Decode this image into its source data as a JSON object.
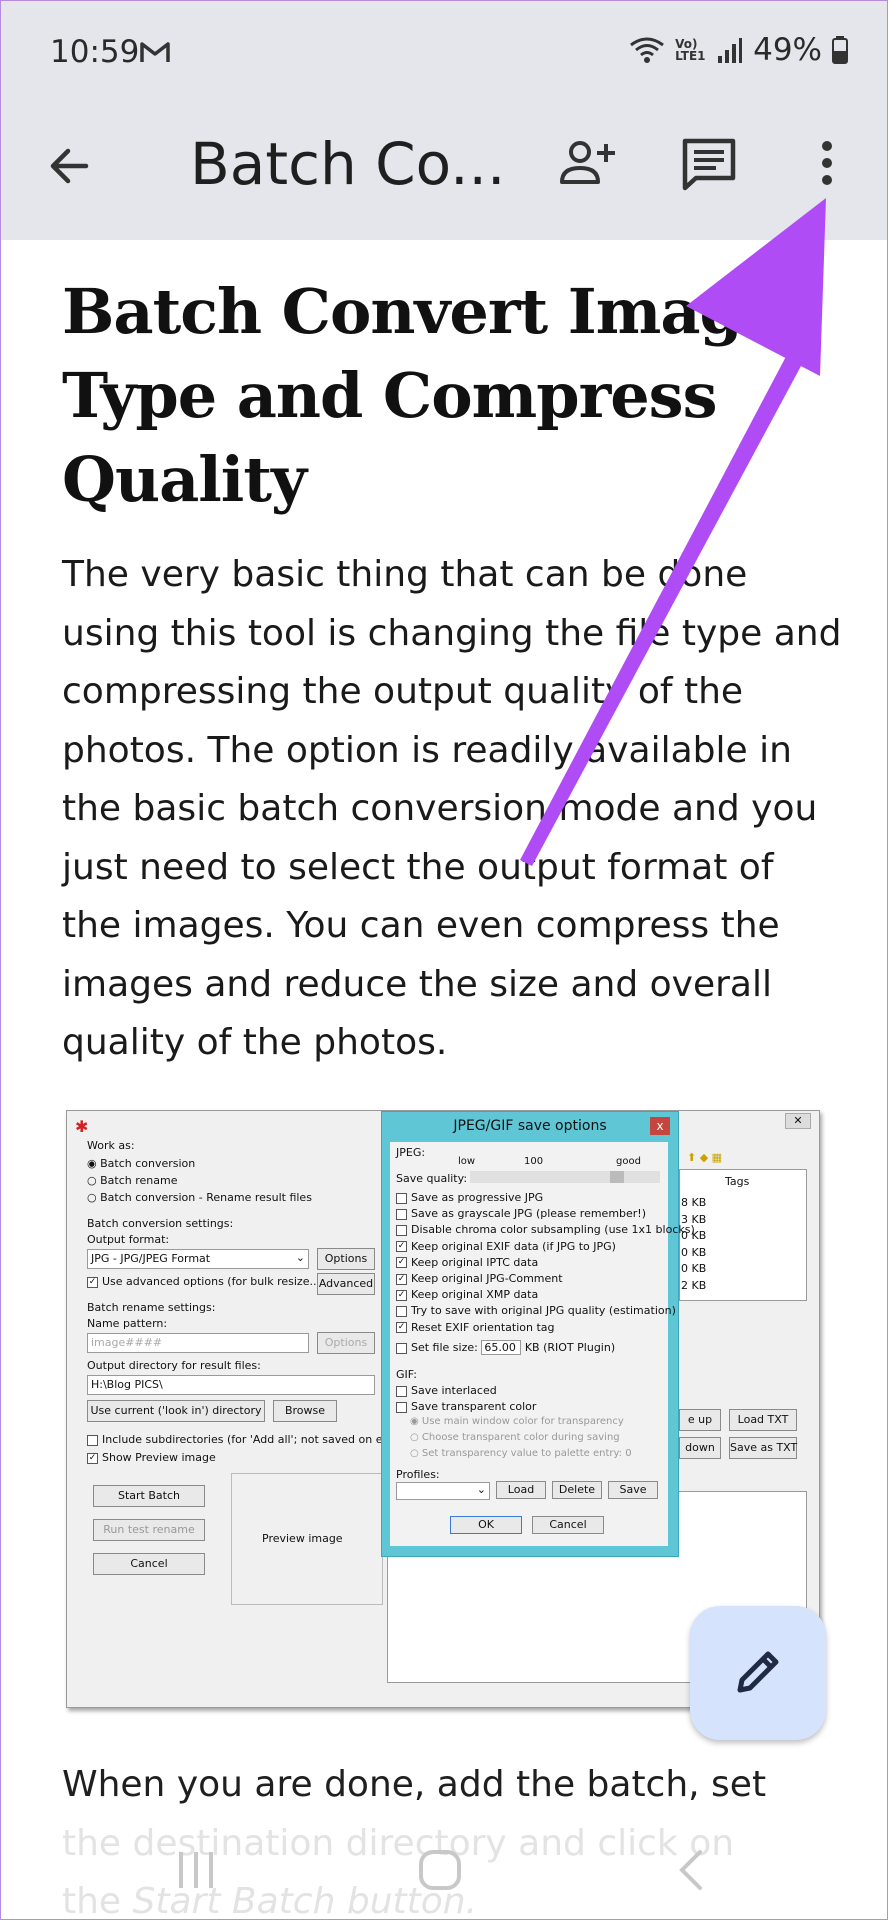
{
  "status_bar": {
    "time": "10:59",
    "battery": "49%",
    "network": "Vo) LTE1"
  },
  "app_bar": {
    "title": "Batch Co..."
  },
  "article": {
    "heading": "Batch Convert Image Type and Compress Quality",
    "paragraph": "The very basic thing that can be done using this tool is changing the file type and compressing the output quality of the photos. The option is readily available in the basic batch conversion mode and you just need to select the output format of the images. You can even compress the images and reduce the size and overall quality of the photos.",
    "continued_line1": "When you are done, add the batch, set",
    "continued_line2": "the destination directory and click on",
    "continued_line3_prefix": "the ",
    "continued_line3_italic": "Start Batch button."
  },
  "embedded_screenshot": {
    "work_as": "Work as:",
    "opt_batch_conversion": "Batch conversion",
    "opt_batch_rename": "Batch rename",
    "opt_batch_both": "Batch conversion - Rename result files",
    "conv_settings": "Batch conversion settings:",
    "output_format_label": "Output format:",
    "output_format_value": "JPG - JPG/JPEG Format",
    "options_btn": "Options",
    "advanced_check": "Use advanced options (for bulk resize...)",
    "advanced_btn": "Advanced",
    "rename_settings": "Batch rename settings:",
    "name_pattern": "Name pattern:",
    "name_pattern_value": "image####",
    "options_btn2": "Options",
    "output_dir_label": "Output directory for result files:",
    "output_dir_value": "H:\\Blog PICS\\",
    "use_current_btn": "Use current ('look in') directory",
    "browse_btn": "Browse",
    "include_subdirs": "Include subdirectories (for 'Add all'; not saved on exit)",
    "show_preview": "Show Preview image",
    "start_batch_btn": "Start Batch",
    "run_test_btn": "Run test rename",
    "cancel_btn": "Cancel",
    "preview_image": "Preview image",
    "tags_header": "Tags",
    "sizes": [
      "8 KB",
      "3 KB",
      "0 KB",
      "0 KB",
      "0 KB",
      "2 KB"
    ],
    "move_up": "e up",
    "move_down": "down",
    "load_txt": "Load TXT",
    "save_txt": "Save as TXT",
    "dialog": {
      "title": "JPEG/GIF save options",
      "close": "x",
      "jpeg_label": "JPEG:",
      "low": "low",
      "quality_value": "100",
      "good": "good",
      "save_quality": "Save quality:",
      "options": [
        {
          "label": "Save as progressive JPG",
          "checked": false
        },
        {
          "label": "Save as grayscale JPG (please remember!)",
          "checked": false
        },
        {
          "label": "Disable chroma color subsampling (use 1x1 blocks)",
          "checked": false
        },
        {
          "label": "Keep original EXIF data (if JPG to JPG)",
          "checked": true
        },
        {
          "label": "Keep original IPTC data",
          "checked": true
        },
        {
          "label": "Keep original JPG-Comment",
          "checked": true
        },
        {
          "label": "Keep original XMP data",
          "checked": true
        },
        {
          "label": "Try to save with original JPG quality (estimation)",
          "checked": false
        },
        {
          "label": "Reset EXIF orientation tag",
          "checked": true
        }
      ],
      "set_file_size": "Set file size:",
      "file_size_value": "65.00",
      "file_size_unit": "KB (RIOT Plugin)",
      "gif_label": "GIF:",
      "save_interlaced": "Save interlaced",
      "save_transparent": "Save transparent color",
      "use_main_window": "Use main window color for transparency",
      "choose_transparent": "Choose transparent color during saving",
      "set_transparency": "Set transparency value to palette entry:",
      "transparency_value": "0",
      "profiles_label": "Profiles:",
      "load_btn": "Load",
      "delete_btn": "Delete",
      "save_btn": "Save",
      "ok_btn": "OK",
      "cancel_btn": "Cancel"
    }
  },
  "colors": {
    "annotation_arrow": "#b04cf5",
    "bar_bg": "#e4e6ec",
    "fab_bg": "#d5e3fc"
  },
  "icons": [
    "back-arrow-icon",
    "add-person-icon",
    "comment-icon",
    "more-vert-icon",
    "edit-pencil-icon",
    "recents-icon",
    "home-icon",
    "back-nav-icon",
    "gmail-icon",
    "wifi-icon",
    "signal-icon",
    "battery-icon"
  ]
}
